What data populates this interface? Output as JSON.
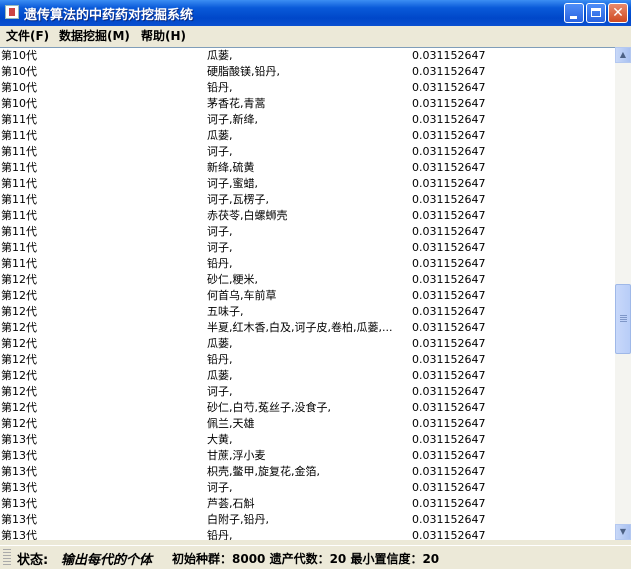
{
  "window": {
    "title": "遗传算法的中药药对挖掘系统"
  },
  "menu": {
    "file": "文件(F)",
    "mining": "数据挖掘(M)",
    "help": "帮助(H)"
  },
  "rows": [
    {
      "gen": "第10代",
      "herbs": "瓜蒌,",
      "value": "0.031152647"
    },
    {
      "gen": "第10代",
      "herbs": "硬脂酸镁,铅丹,",
      "value": "0.031152647"
    },
    {
      "gen": "第10代",
      "herbs": "铅丹,",
      "value": "0.031152647"
    },
    {
      "gen": "第10代",
      "herbs": "茅香花,青蒿",
      "value": "0.031152647"
    },
    {
      "gen": "第11代",
      "herbs": "诃子,新绛,",
      "value": "0.031152647"
    },
    {
      "gen": "第11代",
      "herbs": "瓜蒌,",
      "value": "0.031152647"
    },
    {
      "gen": "第11代",
      "herbs": "诃子,",
      "value": "0.031152647"
    },
    {
      "gen": "第11代",
      "herbs": "新绛,硫黄",
      "value": "0.031152647"
    },
    {
      "gen": "第11代",
      "herbs": "诃子,蜜蜡,",
      "value": "0.031152647"
    },
    {
      "gen": "第11代",
      "herbs": "诃子,瓦楞子,",
      "value": "0.031152647"
    },
    {
      "gen": "第11代",
      "herbs": "赤茯苓,白螺蛳壳",
      "value": "0.031152647"
    },
    {
      "gen": "第11代",
      "herbs": "诃子,",
      "value": "0.031152647"
    },
    {
      "gen": "第11代",
      "herbs": "诃子,",
      "value": "0.031152647"
    },
    {
      "gen": "第11代",
      "herbs": "铅丹,",
      "value": "0.031152647"
    },
    {
      "gen": "第12代",
      "herbs": "砂仁,粳米,",
      "value": "0.031152647"
    },
    {
      "gen": "第12代",
      "herbs": "何首乌,车前草",
      "value": "0.031152647"
    },
    {
      "gen": "第12代",
      "herbs": "五味子,",
      "value": "0.031152647"
    },
    {
      "gen": "第12代",
      "herbs": "半夏,红木香,白及,诃子皮,卷柏,瓜蒌,...",
      "value": "0.031152647"
    },
    {
      "gen": "第12代",
      "herbs": "瓜蒌,",
      "value": "0.031152647"
    },
    {
      "gen": "第12代",
      "herbs": "铅丹,",
      "value": "0.031152647"
    },
    {
      "gen": "第12代",
      "herbs": "瓜蒌,",
      "value": "0.031152647"
    },
    {
      "gen": "第12代",
      "herbs": "诃子,",
      "value": "0.031152647"
    },
    {
      "gen": "第12代",
      "herbs": "砂仁,白芍,菟丝子,没食子,",
      "value": "0.031152647"
    },
    {
      "gen": "第12代",
      "herbs": "佩兰,天雄",
      "value": "0.031152647"
    },
    {
      "gen": "第13代",
      "herbs": "大黄,",
      "value": "0.031152647"
    },
    {
      "gen": "第13代",
      "herbs": "甘蔗,浮小麦",
      "value": "0.031152647"
    },
    {
      "gen": "第13代",
      "herbs": "枳壳,鳖甲,旋复花,金箔,",
      "value": "0.031152647"
    },
    {
      "gen": "第13代",
      "herbs": "诃子,",
      "value": "0.031152647"
    },
    {
      "gen": "第13代",
      "herbs": "芦荟,石斛",
      "value": "0.031152647"
    },
    {
      "gen": "第13代",
      "herbs": "白附子,铅丹,",
      "value": "0.031152647"
    },
    {
      "gen": "第13代",
      "herbs": "铅丹,",
      "value": "0.031152647"
    }
  ],
  "status": {
    "label": "状态:",
    "text": "输出每代的个体",
    "info": "初始种群：8000   遗产代数：20   最小置信度：20"
  }
}
